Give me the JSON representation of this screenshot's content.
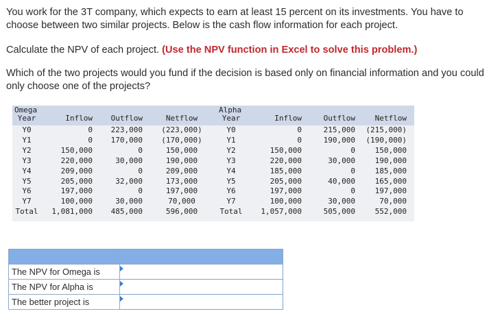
{
  "intro": "You work for the 3T company, which expects to earn at least 15 percent on its investments. You have to choose between two similar projects. Below is the cash flow information for each project.",
  "task_prefix": "Calculate the NPV of each project.",
  "task_instruction": "(Use the NPV function in Excel to solve this problem.)",
  "question": "Which of the two projects would you fund if the decision is based only on financial information and you could only choose one of the projects?",
  "cashflow": {
    "omega": {
      "name": "Omega",
      "headers": [
        "Year",
        "Inflow",
        "Outflow",
        "Netflow"
      ],
      "rows": [
        [
          "Y0",
          "0",
          "223,000",
          "(223,000)"
        ],
        [
          "Y1",
          "0",
          "170,000",
          "(170,000)"
        ],
        [
          "Y2",
          "150,000",
          "0",
          "150,000"
        ],
        [
          "Y3",
          "220,000",
          "30,000",
          "190,000"
        ],
        [
          "Y4",
          "209,000",
          "0",
          "209,000"
        ],
        [
          "Y5",
          "205,000",
          "32,000",
          "173,000"
        ],
        [
          "Y6",
          "197,000",
          "0",
          "197,000"
        ],
        [
          "Y7",
          "100,000",
          "30,000",
          "70,000"
        ],
        [
          "Total",
          "1,081,000",
          "485,000",
          "596,000"
        ]
      ]
    },
    "alpha": {
      "name": "Alpha",
      "headers": [
        "Year",
        "Inflow",
        "Outflow",
        "Netflow"
      ],
      "rows": [
        [
          "Y0",
          "0",
          "215,000",
          "(215,000)"
        ],
        [
          "Y1",
          "0",
          "190,000",
          "(190,000)"
        ],
        [
          "Y2",
          "150,000",
          "0",
          "150,000"
        ],
        [
          "Y3",
          "220,000",
          "30,000",
          "190,000"
        ],
        [
          "Y4",
          "185,000",
          "0",
          "185,000"
        ],
        [
          "Y5",
          "205,000",
          "40,000",
          "165,000"
        ],
        [
          "Y6",
          "197,000",
          "0",
          "197,000"
        ],
        [
          "Y7",
          "100,000",
          "30,000",
          "70,000"
        ],
        [
          "Total",
          "1,057,000",
          "505,000",
          "552,000"
        ]
      ]
    }
  },
  "answers": {
    "npv_omega_label": "The NPV for Omega is",
    "npv_alpha_label": "The NPV for Alpha is",
    "better_label": "The better project is",
    "npv_omega_value": "",
    "npv_alpha_value": "",
    "better_value": ""
  },
  "colors": {
    "instruction_red": "#c0282d",
    "table_header_bg": "#cfd8e8",
    "table_body_bg": "#eef0f3",
    "answer_header_bg": "#83aee6",
    "input_flag": "#3b7dd8"
  }
}
